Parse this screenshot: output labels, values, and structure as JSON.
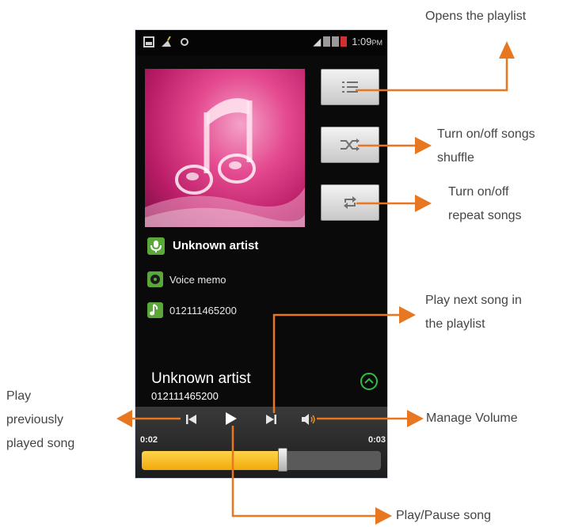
{
  "status_bar": {
    "time": "1:09",
    "time_suffix": "PM"
  },
  "track": {
    "artist": "Unknown artist",
    "album": "Voice memo",
    "title": "012111465200"
  },
  "now_playing": {
    "artist": "Unknown artist",
    "title": "012111465200"
  },
  "playback": {
    "elapsed": "0:02",
    "duration": "0:03",
    "progress": 0.59
  },
  "callouts": {
    "playlist": "Opens the playlist",
    "shuffle_1": "Turn on/off songs",
    "shuffle_2": "shuffle",
    "repeat_1": "Turn on/off",
    "repeat_2": "repeat songs",
    "next_1": "Play next song in",
    "next_2": "the playlist",
    "prev_1": "Play",
    "prev_2": "previously",
    "prev_3": "played song",
    "volume": "Manage Volume",
    "play": "Play/Pause song"
  },
  "colors": {
    "arrow": "#e87722",
    "accent_green": "#5aa83a",
    "progress": "#f2a90a"
  },
  "icons": [
    "playlist-icon",
    "shuffle-icon",
    "repeat-icon",
    "microphone-icon",
    "album-icon",
    "music-note-icon",
    "chevron-up-icon",
    "previous-icon",
    "play-icon",
    "next-icon",
    "volume-icon"
  ]
}
